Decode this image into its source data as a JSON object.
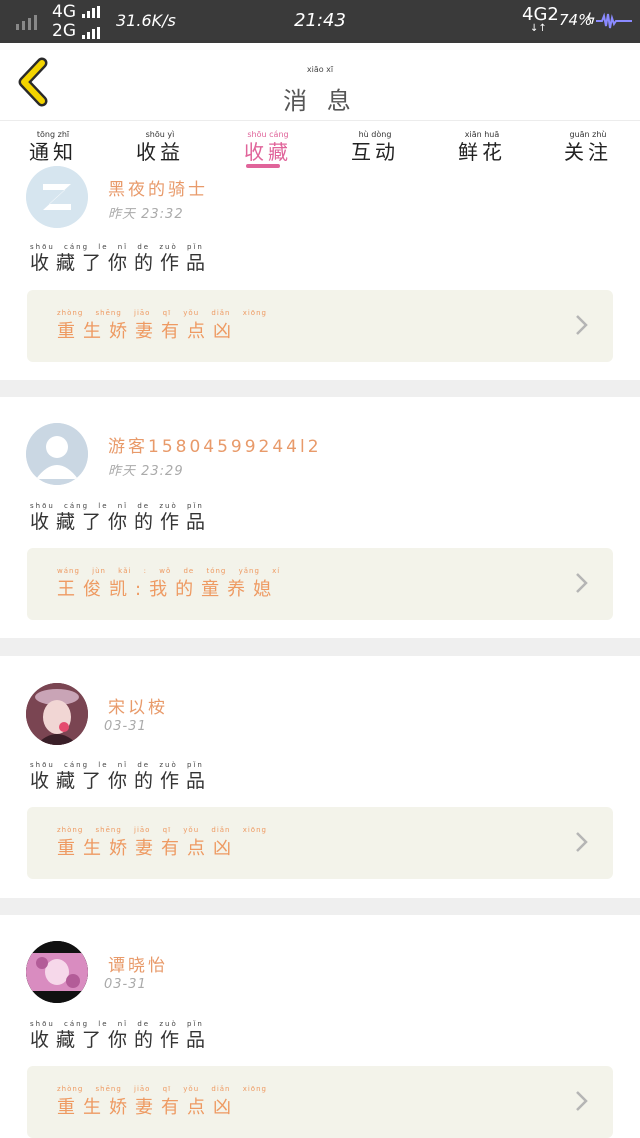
{
  "status_bar": {
    "network_1": "4G",
    "network_2": "2G",
    "speed": "31.6K/s",
    "time": "21:43",
    "network_right": "4G2",
    "battery": "74%"
  },
  "header": {
    "title": "消 息",
    "title_pinyin": "xiāo   xī",
    "back_icon": "chevron-left-icon"
  },
  "tabs": [
    {
      "label": "通知",
      "pinyin": "tōng  zhī",
      "active": false
    },
    {
      "label": "收益",
      "pinyin": "shōu  yì",
      "active": false
    },
    {
      "label": "收藏",
      "pinyin": "shōu  cáng",
      "active": true
    },
    {
      "label": "互动",
      "pinyin": "hù   dòng",
      "active": false
    },
    {
      "label": "鲜花",
      "pinyin": "xiān  huā",
      "active": false
    },
    {
      "label": "关注",
      "pinyin": "guān  zhù",
      "active": false
    }
  ],
  "items": [
    {
      "user": "黑夜的骑士",
      "time": "昨天 23:32",
      "action": "收藏了你的作品",
      "action_pinyin": "shōu cáng le nǐ de zuò pǐn",
      "work": "重生娇妻有点凶",
      "work_pinyin": "zhòng shēng jiāo qī yǒu diǎn xiōng",
      "avatar": "default-avatar-icon"
    },
    {
      "user": "游客15804599244l2",
      "time": "昨天 23:29",
      "action": "收藏了你的作品",
      "action_pinyin": "shōu cáng le nǐ de zuò pǐn",
      "work": "王俊凯:我的童养媳",
      "work_pinyin": "wáng jùn kǎi : wǒ de tóng yǎng xí",
      "avatar": "default-avatar-icon"
    },
    {
      "user": "宋以桉",
      "time": "03-31",
      "action": "收藏了你的作品",
      "action_pinyin": "shōu cáng le nǐ de zuò pǐn",
      "work": "重生娇妻有点凶",
      "work_pinyin": "zhòng shēng jiāo qī yǒu diǎn xiōng",
      "avatar": "photo-avatar"
    },
    {
      "user": "谭晓怡",
      "time": "03-31",
      "action": "收藏了你的作品",
      "action_pinyin": "shōu cáng le nǐ de zuò pǐn",
      "work": "重生娇妻有点凶",
      "work_pinyin": "zhòng shēng jiāo qī yǒu diǎn xiōng",
      "avatar": "photo-avatar"
    }
  ],
  "colors": {
    "accent": "#e0649a",
    "username": "#e89a6a",
    "work_title": "#ee9a62",
    "work_bg": "#f3f3ea",
    "back_arrow": "#f0d500"
  }
}
